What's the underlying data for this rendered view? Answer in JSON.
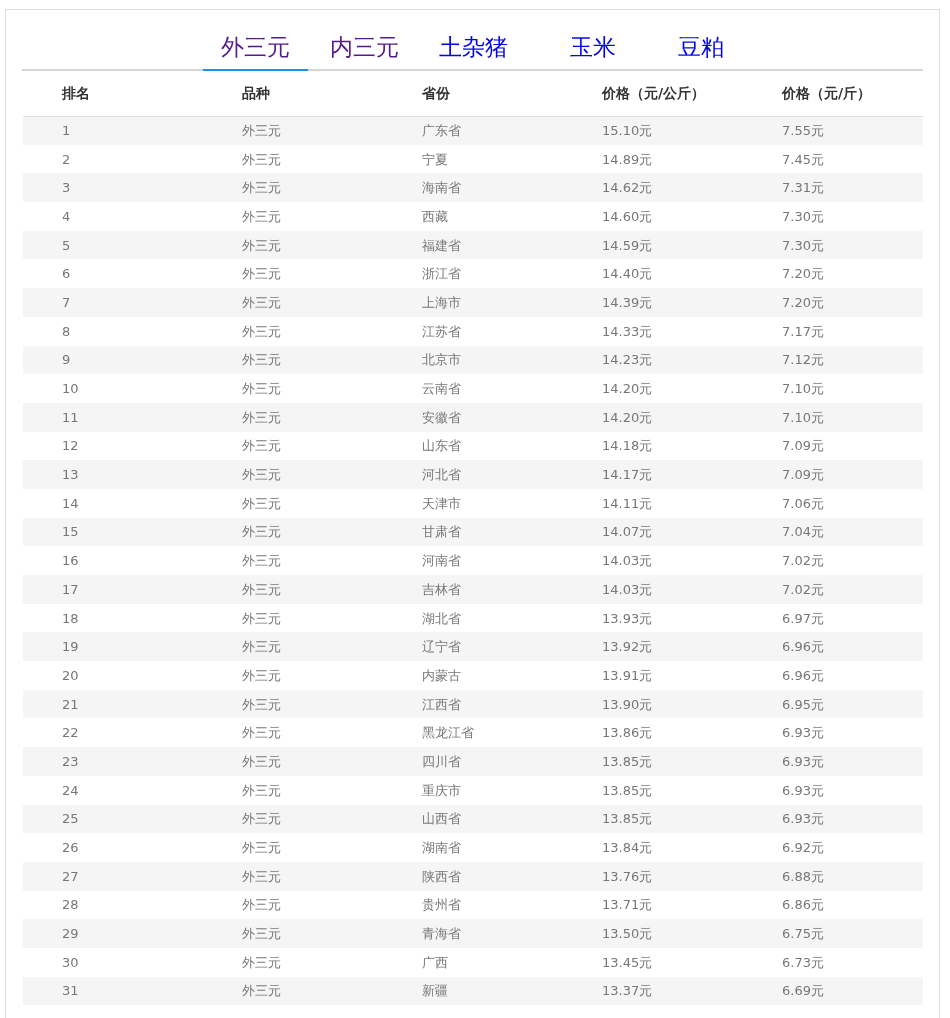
{
  "tabs": [
    {
      "label": "外三元",
      "selected": true,
      "visited": true
    },
    {
      "label": "内三元",
      "selected": false,
      "visited": true
    },
    {
      "label": "土杂猪",
      "selected": false,
      "visited": false
    },
    {
      "label": "玉米",
      "selected": false,
      "visited": false
    },
    {
      "label": "豆粕",
      "selected": false,
      "visited": false
    }
  ],
  "table": {
    "columns": [
      "排名",
      "品种",
      "省份",
      "价格（元/公斤）",
      "价格（元/斤）"
    ],
    "rows": [
      [
        "1",
        "外三元",
        "广东省",
        "15.10元",
        "7.55元"
      ],
      [
        "2",
        "外三元",
        "宁夏",
        "14.89元",
        "7.45元"
      ],
      [
        "3",
        "外三元",
        "海南省",
        "14.62元",
        "7.31元"
      ],
      [
        "4",
        "外三元",
        "西藏",
        "14.60元",
        "7.30元"
      ],
      [
        "5",
        "外三元",
        "福建省",
        "14.59元",
        "7.30元"
      ],
      [
        "6",
        "外三元",
        "浙江省",
        "14.40元",
        "7.20元"
      ],
      [
        "7",
        "外三元",
        "上海市",
        "14.39元",
        "7.20元"
      ],
      [
        "8",
        "外三元",
        "江苏省",
        "14.33元",
        "7.17元"
      ],
      [
        "9",
        "外三元",
        "北京市",
        "14.23元",
        "7.12元"
      ],
      [
        "10",
        "外三元",
        "云南省",
        "14.20元",
        "7.10元"
      ],
      [
        "11",
        "外三元",
        "安徽省",
        "14.20元",
        "7.10元"
      ],
      [
        "12",
        "外三元",
        "山东省",
        "14.18元",
        "7.09元"
      ],
      [
        "13",
        "外三元",
        "河北省",
        "14.17元",
        "7.09元"
      ],
      [
        "14",
        "外三元",
        "天津市",
        "14.11元",
        "7.06元"
      ],
      [
        "15",
        "外三元",
        "甘肃省",
        "14.07元",
        "7.04元"
      ],
      [
        "16",
        "外三元",
        "河南省",
        "14.03元",
        "7.02元"
      ],
      [
        "17",
        "外三元",
        "吉林省",
        "14.03元",
        "7.02元"
      ],
      [
        "18",
        "外三元",
        "湖北省",
        "13.93元",
        "6.97元"
      ],
      [
        "19",
        "外三元",
        "辽宁省",
        "13.92元",
        "6.96元"
      ],
      [
        "20",
        "外三元",
        "内蒙古",
        "13.91元",
        "6.96元"
      ],
      [
        "21",
        "外三元",
        "江西省",
        "13.90元",
        "6.95元"
      ],
      [
        "22",
        "外三元",
        "黑龙江省",
        "13.86元",
        "6.93元"
      ],
      [
        "23",
        "外三元",
        "四川省",
        "13.85元",
        "6.93元"
      ],
      [
        "24",
        "外三元",
        "重庆市",
        "13.85元",
        "6.93元"
      ],
      [
        "25",
        "外三元",
        "山西省",
        "13.85元",
        "6.93元"
      ],
      [
        "26",
        "外三元",
        "湖南省",
        "13.84元",
        "6.92元"
      ],
      [
        "27",
        "外三元",
        "陕西省",
        "13.76元",
        "6.88元"
      ],
      [
        "28",
        "外三元",
        "贵州省",
        "13.71元",
        "6.86元"
      ],
      [
        "29",
        "外三元",
        "青海省",
        "13.50元",
        "6.75元"
      ],
      [
        "30",
        "外三元",
        "广西",
        "13.45元",
        "6.73元"
      ],
      [
        "31",
        "外三元",
        "新疆",
        "13.37元",
        "6.69元"
      ]
    ]
  }
}
